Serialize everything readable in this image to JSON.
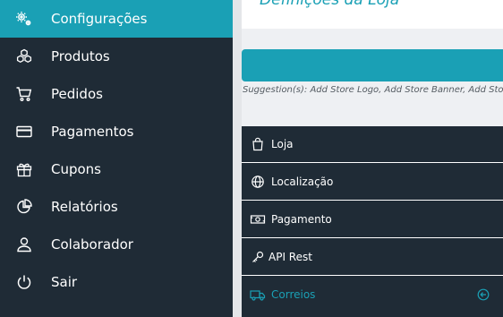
{
  "sidebar": {
    "items": [
      {
        "label": "Configurações",
        "icon": "gears-icon",
        "active": true
      },
      {
        "label": "Produtos",
        "icon": "cubes-icon"
      },
      {
        "label": "Pedidos",
        "icon": "cart-icon"
      },
      {
        "label": "Pagamentos",
        "icon": "credit-card-icon"
      },
      {
        "label": "Cupons",
        "icon": "gift-icon"
      },
      {
        "label": "Relatórios",
        "icon": "pie-chart-icon"
      },
      {
        "label": "Colaborador",
        "icon": "user-icon"
      },
      {
        "label": "Sair",
        "icon": "power-icon"
      }
    ]
  },
  "main": {
    "title": "Definições da Loja",
    "suggestions": "Suggestion(s): Add Store Logo, Add Store Banner, Add Store Address",
    "menu": [
      {
        "label": "Loja",
        "icon": "shopping-bag-icon"
      },
      {
        "label": "Localização",
        "icon": "globe-icon"
      },
      {
        "label": "Pagamento",
        "icon": "money-icon"
      },
      {
        "label": "API Rest",
        "icon": "key-icon"
      },
      {
        "label": "Correios",
        "icon": "truck-icon",
        "active": true,
        "trailing_icon": "arrow-circle-icon"
      }
    ]
  },
  "colors": {
    "accent": "#1aa0b5",
    "dark": "#1f2b36",
    "background": "#eef0f3"
  }
}
